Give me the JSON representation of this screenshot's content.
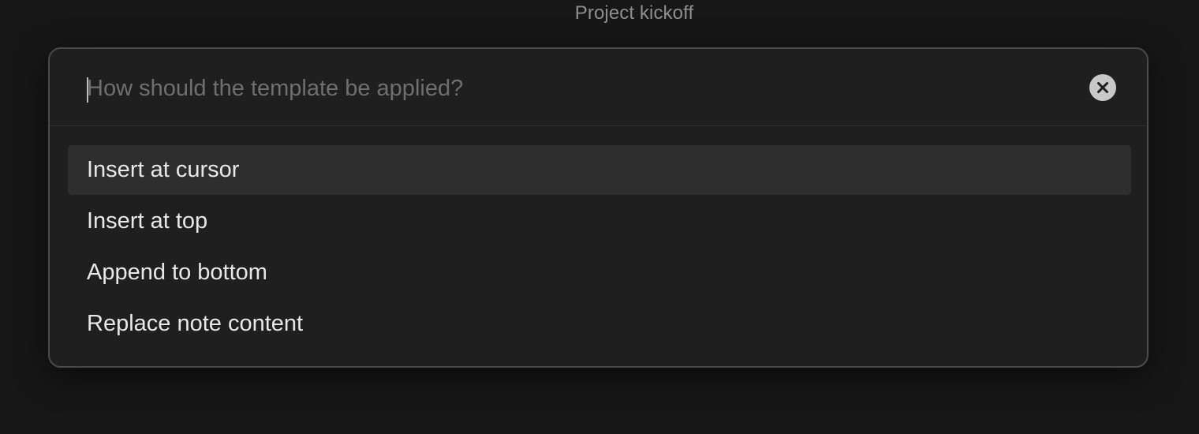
{
  "window": {
    "title": "Project kickoff"
  },
  "prompt": {
    "search": {
      "value": "",
      "placeholder": "How should the template be applied?"
    },
    "clear_icon": "close-circle-icon",
    "options": [
      {
        "label": "Insert at cursor",
        "selected": true
      },
      {
        "label": "Insert at top",
        "selected": false
      },
      {
        "label": "Append to bottom",
        "selected": false
      },
      {
        "label": "Replace note content",
        "selected": false
      }
    ]
  },
  "colors": {
    "background": "#171717",
    "modal": "#1f1f1f",
    "selected_row": "#2e2e2e",
    "text": "#e8e8e8",
    "placeholder": "#6f6f6f"
  }
}
